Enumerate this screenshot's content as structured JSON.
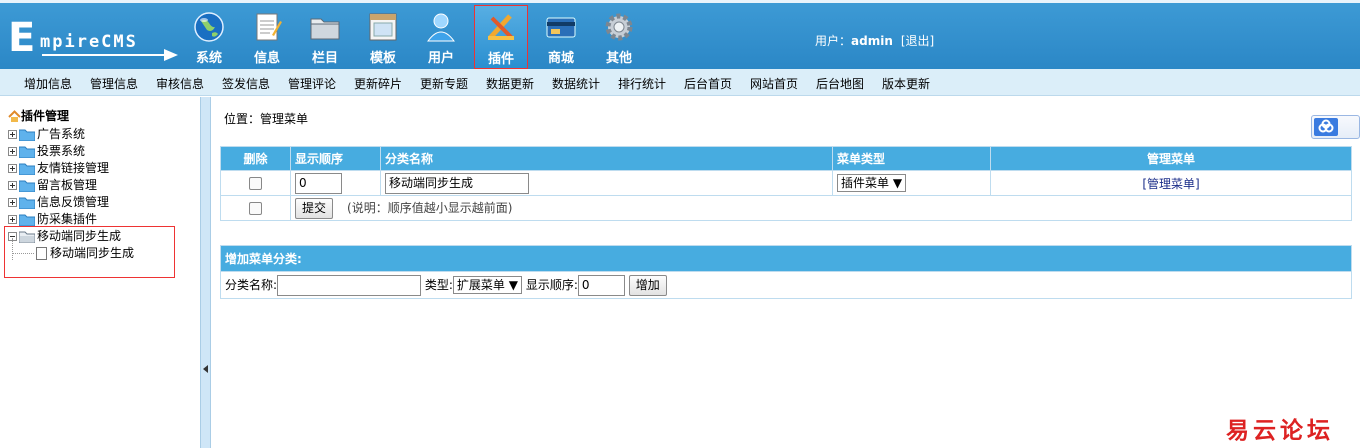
{
  "header": {
    "logo_first_letter": "E",
    "logo_rest": "mpireCMS",
    "nav": [
      {
        "label": "系统",
        "icon": "globe-icon"
      },
      {
        "label": "信息",
        "icon": "document-icon"
      },
      {
        "label": "栏目",
        "icon": "folder-icon"
      },
      {
        "label": "模板",
        "icon": "template-icon"
      },
      {
        "label": "用户",
        "icon": "user-icon"
      },
      {
        "label": "插件",
        "icon": "plugin-tools-icon",
        "active": true
      },
      {
        "label": "商城",
        "icon": "card-icon"
      },
      {
        "label": "其他",
        "icon": "gear-icon"
      }
    ],
    "user_prefix": "用户：",
    "username": "admin",
    "logout": "[退出]"
  },
  "submenu": [
    "增加信息",
    "管理信息",
    "审核信息",
    "签发信息",
    "管理评论",
    "更新碎片",
    "更新专题",
    "数据更新",
    "数据统计",
    "排行统计",
    "后台首页",
    "网站首页",
    "后台地图",
    "版本更新"
  ],
  "tree": {
    "title": "插件管理",
    "items": [
      "广告系统",
      "投票系统",
      "友情链接管理",
      "留言板管理",
      "信息反馈管理",
      "防采集插件",
      "移动端同步生成"
    ],
    "child": "移动端同步生成"
  },
  "main": {
    "location": "位置：管理菜单",
    "table": {
      "headers": [
        "删除",
        "显示顺序",
        "分类名称",
        "菜单类型",
        "管理菜单"
      ],
      "row": {
        "order": "0",
        "name": "移动端同步生成",
        "type": "插件菜单",
        "manage": "[管理菜单]"
      },
      "submit": "提交",
      "note": "(说明：顺序值越小显示越前面)"
    },
    "add": {
      "title": "增加菜单分类:",
      "name_label": "分类名称:",
      "name_value": "",
      "type_label": "类型:",
      "type_value": "扩展菜单",
      "order_label": "显示顺序:",
      "order_value": "0",
      "button": "增加"
    }
  },
  "watermark": "易云论坛",
  "colors": {
    "header": "#2b87c6",
    "table_header": "#47ace0",
    "submenu": "#dbeef9",
    "highlight_border": "#e33333"
  }
}
